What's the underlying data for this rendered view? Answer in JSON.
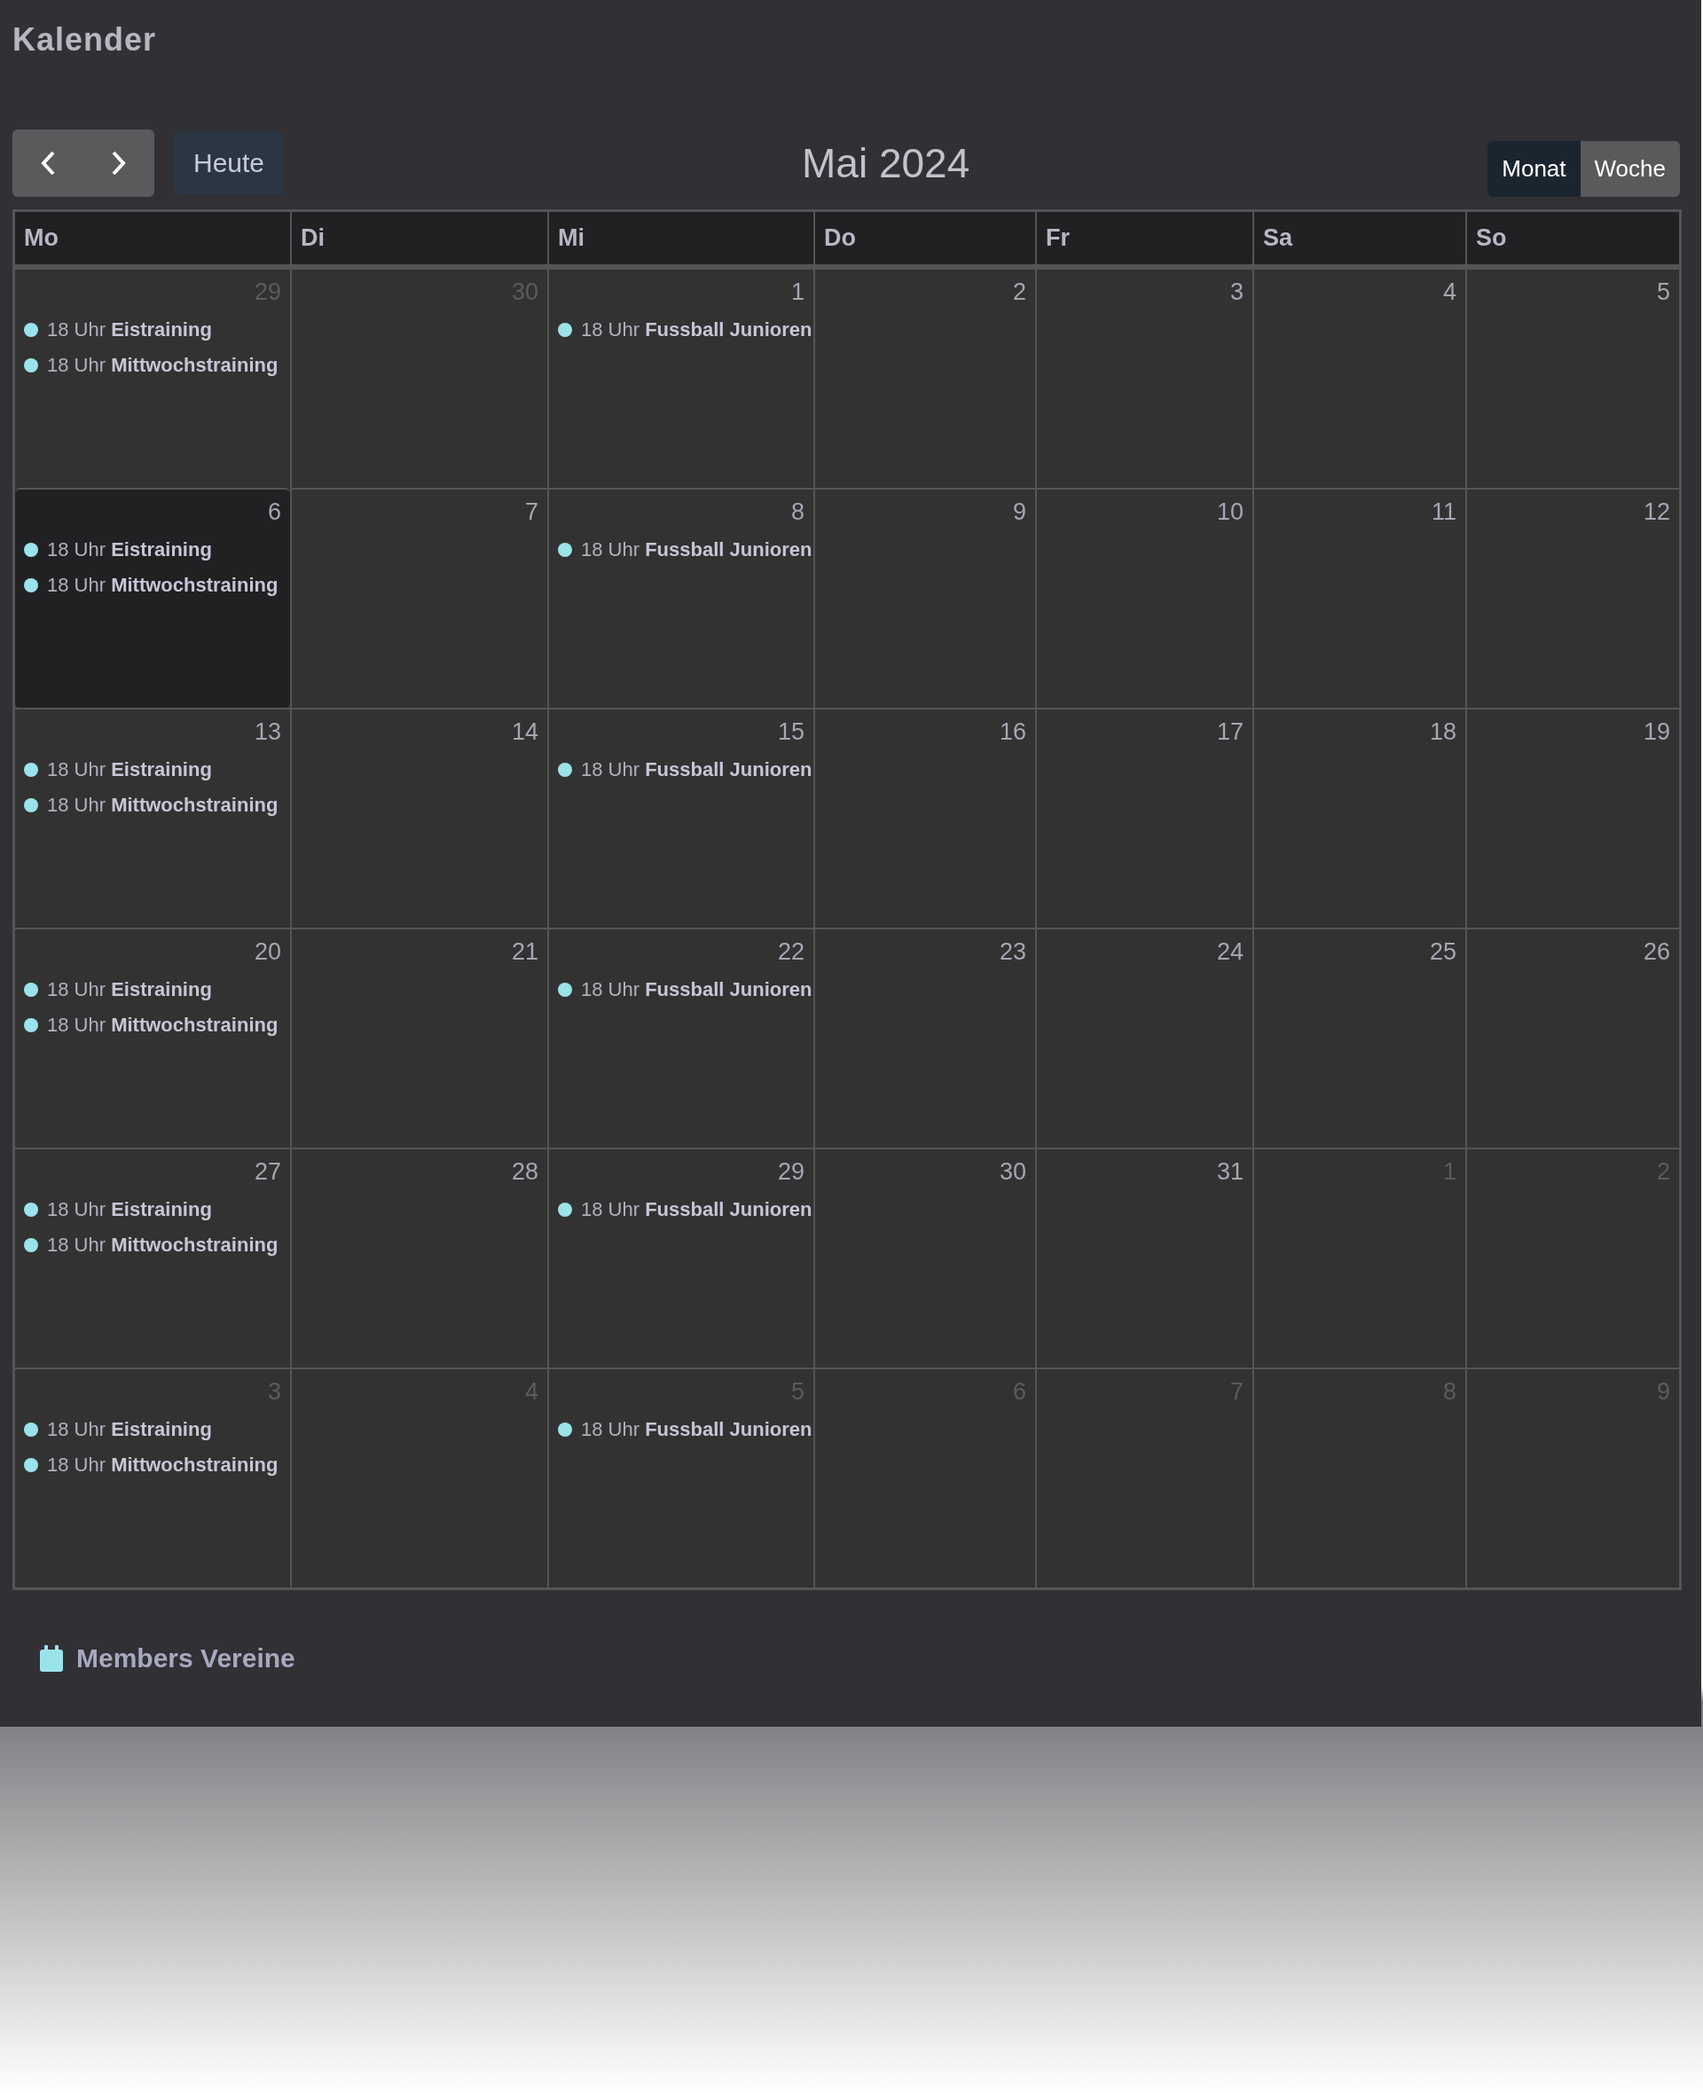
{
  "page_title": "Kalender",
  "toolbar": {
    "today_label": "Heute",
    "month_title": "Mai 2024",
    "views": [
      {
        "label": "Monat",
        "selected": true
      },
      {
        "label": "Woche",
        "selected": false
      }
    ]
  },
  "weekdays": [
    "Mo",
    "Di",
    "Mi",
    "Do",
    "Fr",
    "Sa",
    "So"
  ],
  "weeks": [
    {
      "days": [
        {
          "day": "29",
          "other_month": true,
          "today": false,
          "events": [
            {
              "text": "18 Uhr **Eistraining**",
              "color": "#9be3ea"
            },
            {
              "text": "18 Uhr **Mittwochstraining**",
              "color": "#9be3ea"
            }
          ]
        },
        {
          "day": "30",
          "other_month": true,
          "today": false
        },
        {
          "day": "1",
          "other_month": false,
          "today": false,
          "events": [
            {
              "text": "18 Uhr **Fussball Junioren**",
              "color": "#9be3ea"
            }
          ]
        },
        {
          "day": "2",
          "other_month": false,
          "today": false
        },
        {
          "day": "3",
          "other_month": false,
          "today": false
        },
        {
          "day": "4",
          "other_month": false,
          "today": false
        },
        {
          "day": "5",
          "other_month": false,
          "today": false
        }
      ]
    },
    {
      "days": [
        {
          "day": "6",
          "other_month": false,
          "today": true,
          "events": [
            {
              "text": "18 Uhr **Eistraining**",
              "color": "#9be3ea"
            },
            {
              "text": "18 Uhr **Mittwochstraining**",
              "color": "#9be3ea"
            }
          ]
        },
        {
          "day": "7",
          "other_month": false,
          "today": false
        },
        {
          "day": "8",
          "other_month": false,
          "today": false,
          "events": [
            {
              "text": "18 Uhr **Fussball Junioren**",
              "color": "#9be3ea"
            }
          ]
        },
        {
          "day": "9",
          "other_month": false,
          "today": false
        },
        {
          "day": "10",
          "other_month": false,
          "today": false
        },
        {
          "day": "11",
          "other_month": false,
          "today": false
        },
        {
          "day": "12",
          "other_month": false,
          "today": false
        }
      ]
    },
    {
      "days": [
        {
          "day": "13",
          "other_month": false,
          "today": false,
          "events": [
            {
              "text": "18 Uhr **Eistraining**",
              "color": "#9be3ea"
            },
            {
              "text": "18 Uhr **Mittwochstraining**",
              "color": "#9be3ea"
            }
          ]
        },
        {
          "day": "14",
          "other_month": false,
          "today": false
        },
        {
          "day": "15",
          "other_month": false,
          "today": false,
          "events": [
            {
              "text": "18 Uhr **Fussball Junioren**",
              "color": "#9be3ea"
            }
          ]
        },
        {
          "day": "16",
          "other_month": false,
          "today": false
        },
        {
          "day": "17",
          "other_month": false,
          "today": false
        },
        {
          "day": "18",
          "other_month": false,
          "today": false
        },
        {
          "day": "19",
          "other_month": false,
          "today": false
        }
      ]
    },
    {
      "days": [
        {
          "day": "20",
          "other_month": false,
          "today": false,
          "events": [
            {
              "text": "18 Uhr **Eistraining**",
              "color": "#9be3ea"
            },
            {
              "text": "18 Uhr **Mittwochstraining**",
              "color": "#9be3ea"
            }
          ]
        },
        {
          "day": "21",
          "other_month": false,
          "today": false
        },
        {
          "day": "22",
          "other_month": false,
          "today": false,
          "events": [
            {
              "text": "18 Uhr **Fussball Junioren**",
              "color": "#9be3ea"
            }
          ]
        },
        {
          "day": "23",
          "other_month": false,
          "today": false
        },
        {
          "day": "24",
          "other_month": false,
          "today": false
        },
        {
          "day": "25",
          "other_month": false,
          "today": false
        },
        {
          "day": "26",
          "other_month": false,
          "today": false
        }
      ]
    },
    {
      "days": [
        {
          "day": "27",
          "other_month": false,
          "today": false,
          "events": [
            {
              "text": "18 Uhr **Eistraining**",
              "color": "#9be3ea"
            },
            {
              "text": "18 Uhr **Mittwochstraining**",
              "color": "#9be3ea"
            }
          ]
        },
        {
          "day": "28",
          "other_month": false,
          "today": false
        },
        {
          "day": "29",
          "other_month": false,
          "today": false,
          "events": [
            {
              "text": "18 Uhr **Fussball Junioren**",
              "color": "#9be3ea"
            }
          ]
        },
        {
          "day": "30",
          "other_month": false,
          "today": false
        },
        {
          "day": "31",
          "other_month": false,
          "today": false
        },
        {
          "day": "1",
          "other_month": true,
          "today": false
        },
        {
          "day": "2",
          "other_month": true,
          "today": false
        }
      ]
    },
    {
      "days": [
        {
          "day": "3",
          "other_month": true,
          "today": false,
          "events": [
            {
              "text": "18 Uhr **Eistraining**",
              "color": "#9be3ea"
            },
            {
              "text": "18 Uhr **Mittwochstraining**",
              "color": "#9be3ea"
            }
          ]
        },
        {
          "day": "4",
          "other_month": true,
          "today": false
        },
        {
          "day": "5",
          "other_month": true,
          "today": false,
          "events": [
            {
              "text": "18 Uhr **Fussball Junioren**",
              "color": "#9be3ea"
            }
          ]
        },
        {
          "day": "6",
          "other_month": true,
          "today": false
        },
        {
          "day": "7",
          "other_month": true,
          "today": false
        },
        {
          "day": "8",
          "other_month": true,
          "today": false
        },
        {
          "day": "9",
          "other_month": true,
          "today": false
        }
      ]
    }
  ],
  "legend": [
    {
      "label": "Members Vereine",
      "color": "#9be3ea"
    }
  ]
}
